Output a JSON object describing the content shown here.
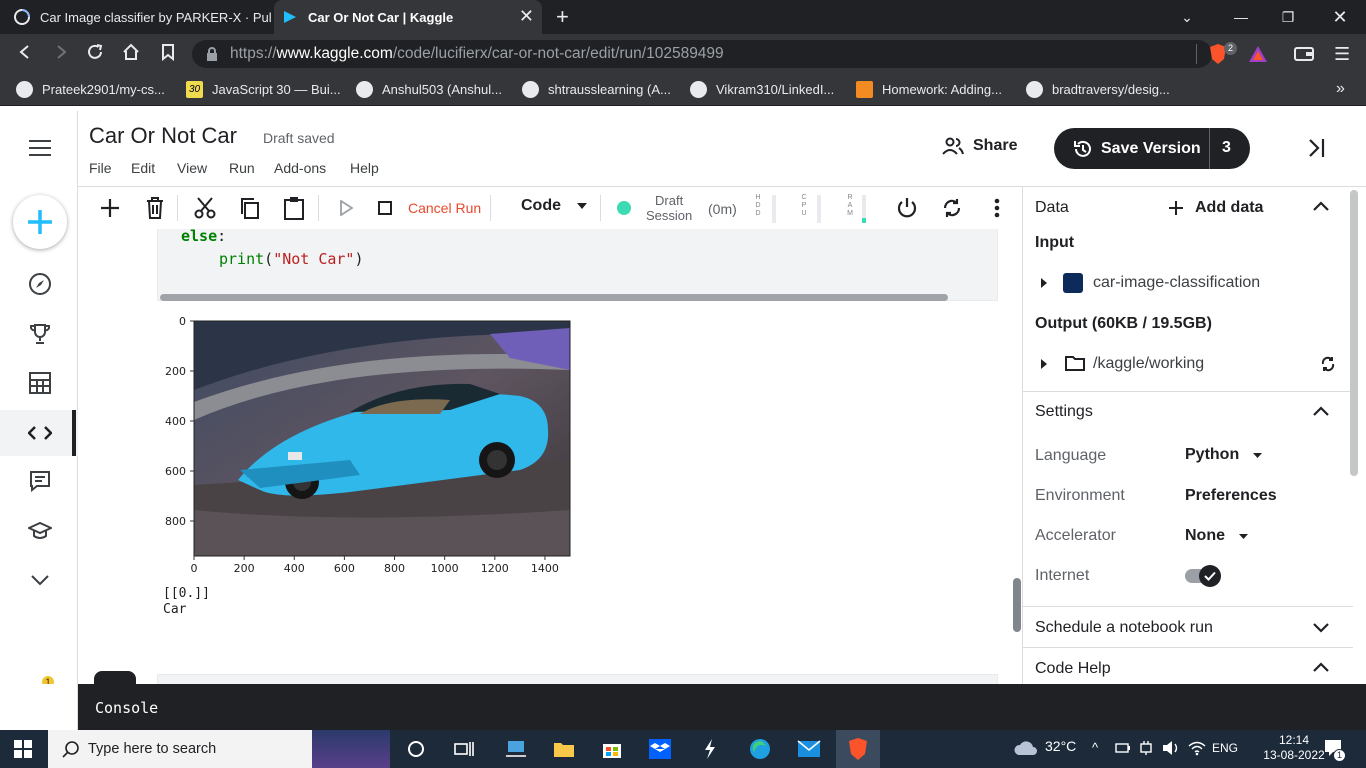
{
  "browser": {
    "tabs": [
      {
        "title": "Car Image classifier by PARKER-X · Pul"
      },
      {
        "title": "Car Or Not Car | Kaggle"
      }
    ],
    "url": {
      "prefix": "https://",
      "domain": "www.kaggle.com",
      "path": "/code/lucifierx/car-or-not-car/edit/run/102589499"
    },
    "brave_badge": "2",
    "bookmarks": [
      {
        "label": "Prateek2901/my-cs..."
      },
      {
        "label": "JavaScript 30 — Bui..."
      },
      {
        "label": "Anshul503 (Anshul..."
      },
      {
        "label": "shtrausslearning (A..."
      },
      {
        "label": "Vikram310/LinkedI..."
      },
      {
        "label": "Homework: Adding..."
      },
      {
        "label": "bradtraversy/desig..."
      }
    ],
    "bookmarks_more": "»"
  },
  "header": {
    "title": "Car Or Not Car",
    "status": "Draft saved",
    "menu": [
      "File",
      "Edit",
      "View",
      "Run",
      "Add-ons",
      "Help"
    ],
    "share_label": "Share",
    "save_label": "Save Version",
    "save_count": "3"
  },
  "toolbar": {
    "cancel_label": "Cancel Run",
    "cell_type": "Code",
    "session_line1": "Draft",
    "session_line2": "Session",
    "session_time": "(0m)",
    "meters": [
      "H D D",
      "C P U",
      "R A M"
    ]
  },
  "code": {
    "line1_keyword": "else",
    "line1_colon": ":",
    "line2_func": "print",
    "line2_open": "(",
    "line2_string": "\"Not Car\"",
    "line2_close": ")"
  },
  "plot": {
    "y_ticks": [
      "0",
      "200",
      "400",
      "600",
      "800"
    ],
    "x_ticks": [
      "0",
      "200",
      "400",
      "600",
      "800",
      "1000",
      "1200",
      "1400"
    ]
  },
  "chart_data": {
    "type": "image",
    "xlim": [
      0,
      1500
    ],
    "ylim": [
      940,
      0
    ],
    "xticks": [
      0,
      200,
      400,
      600,
      800,
      1000,
      1200,
      1400
    ],
    "yticks": [
      0,
      200,
      400,
      600,
      800
    ]
  },
  "output": {
    "line1": "[[0.]]",
    "line2": "Car"
  },
  "panel": {
    "data_label": "Data",
    "add_data_label": "Add data",
    "input_label": "Input",
    "input_item": "car-image-classification",
    "output_label": "Output (60KB / 19.5GB)",
    "output_item": "/kaggle/working",
    "settings_label": "Settings",
    "language_label": "Language",
    "language_value": "Python",
    "environment_label": "Environment",
    "environment_value": "Preferences",
    "accelerator_label": "Accelerator",
    "accelerator_value": "None",
    "internet_label": "Internet",
    "internet_on": true,
    "schedule_label": "Schedule a notebook run",
    "codehelp_label": "Code Help"
  },
  "console": {
    "label": "Console"
  },
  "rail": {
    "notification_badge": "1"
  },
  "taskbar": {
    "search_placeholder": "Type here to search",
    "temperature": "32°C",
    "language": "ENG",
    "time": "12:14",
    "date": "13-08-2022",
    "notification_count": "1"
  },
  "colors": {
    "accent": "#20beff",
    "danger": "#e8492d",
    "session_dot": "#3ddbb3",
    "dark": "#202124"
  }
}
